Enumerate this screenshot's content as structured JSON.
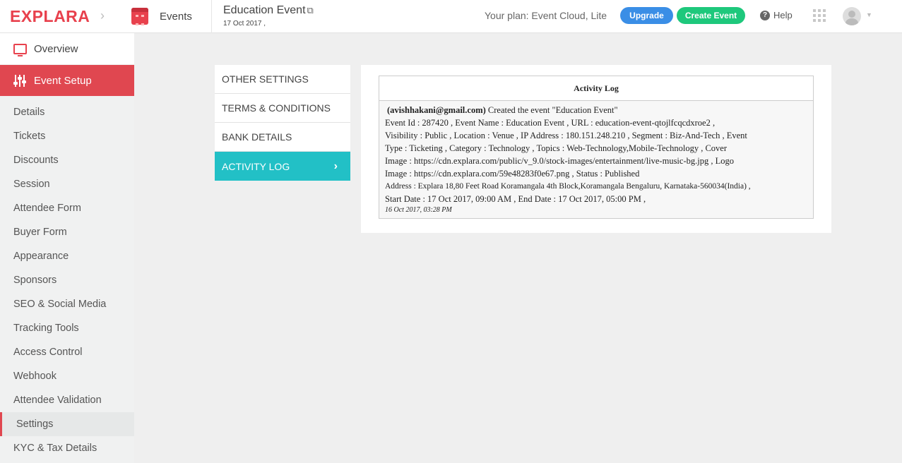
{
  "header": {
    "logo": "EXPLARA",
    "events_label": "Events",
    "event_title": "Education Event",
    "event_date": "17 Oct 2017 ,",
    "plan": "Your plan: Event Cloud, Lite",
    "upgrade_label": "Upgrade",
    "create_event_label": "Create Event",
    "help_label": "Help"
  },
  "sidebar": {
    "overview": "Overview",
    "event_setup": "Event Setup",
    "items": [
      "Details",
      "Tickets",
      "Discounts",
      "Session",
      "Attendee Form",
      "Buyer Form",
      "Appearance",
      "Sponsors",
      "SEO & Social Media",
      "Tracking Tools",
      "Access Control",
      "Webhook",
      "Attendee Validation",
      "Settings",
      "KYC & Tax Details"
    ],
    "active_item": "Settings"
  },
  "settings_tabs": {
    "items": [
      "OTHER SETTINGS",
      "TERMS & CONDITIONS",
      "BANK DETAILS",
      "ACTIVITY LOG"
    ],
    "active": "ACTIVITY LOG"
  },
  "activity_log": {
    "title": "Activity Log",
    "entry": {
      "user": "(avishhakani@gmail.com)",
      "action": " Created the event \"Education Event\"",
      "lines": [
        "Event Id : 287420 ,  Event Name : Education Event ,  URL : education-event-qtojlfcqcdxroe2 ,",
        "Visibility : Public ,  Location : Venue ,  IP Address : 180.151.248.210 ,  Segment : Biz-And-Tech ,  Event",
        "Type : Ticketing ,  Category : Technology ,  Topics : Web-Technology,Mobile-Technology ,  Cover",
        "Image : https://cdn.explara.com/public/v_9.0/stock-images/entertainment/live-music-bg.jpg ,  Logo",
        "Image : https://cdn.explara.com/59e48283f0e67.png ,  Status : Published"
      ],
      "address_line": "Address : Explara 18,80 Feet Road Koramangala 4th Block,Koramangala Bengaluru, Karnataka-560034(India) ,",
      "dates_line": "Start Date :  17 Oct 2017, 09:00 AM  ,  End Date :  17 Oct 2017, 05:00 PM  ,",
      "timestamp": "16 Oct 2017, 03:28 PM"
    }
  },
  "colors": {
    "brand": "#e8414d",
    "upgrade": "#3a8ee6",
    "create": "#1ec87c",
    "active_tab": "#22c0c6"
  }
}
